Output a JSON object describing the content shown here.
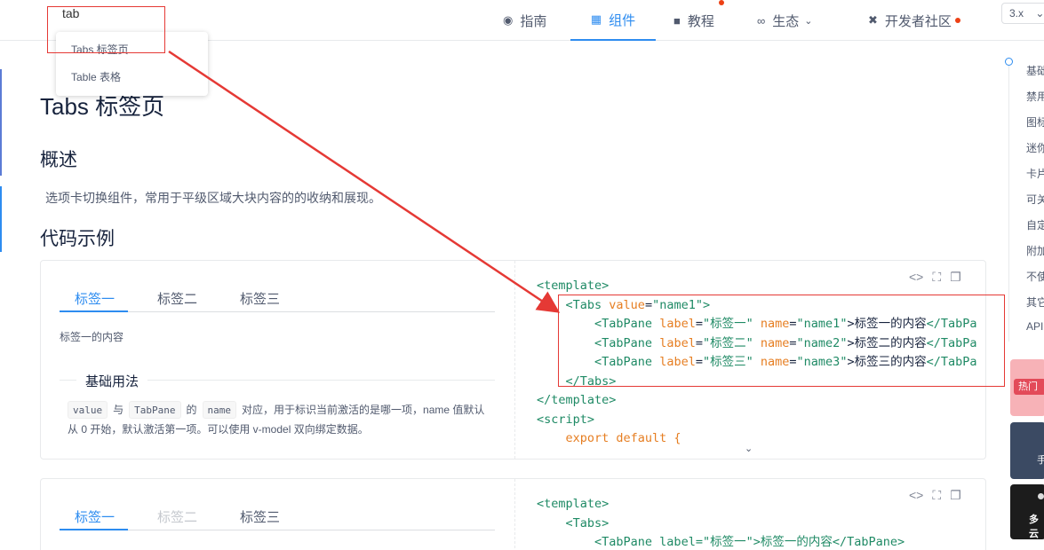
{
  "search": {
    "value": "tab"
  },
  "dropdown": {
    "options": [
      "Tabs 标签页",
      "Table 表格"
    ]
  },
  "nav": {
    "guide": "指南",
    "components": "组件",
    "tutorial": "教程",
    "ecosystem": "生态",
    "dev_community": "开发者社区",
    "version": "3.x"
  },
  "page": {
    "title": "Tabs 标签页",
    "overview_heading": "概述",
    "overview_text": "选项卡切换组件，常用于平级区域大块内容的的收纳和展现。",
    "examples_heading": "代码示例"
  },
  "demo1": {
    "tabs": [
      "标签一",
      "标签二",
      "标签三"
    ],
    "content": "标签一的内容",
    "legend": "基础用法",
    "explain": {
      "chip1": "value",
      "w1": "与",
      "chip2": "TabPane",
      "w2": "的",
      "chip3": "name",
      "rest": "对应，用于标识当前激活的是哪一项，name 值默认从 0 开始，默认激活第一项。可以使用 v-model 双向绑定数据。"
    },
    "code": {
      "l1": "<template>",
      "l2_tag": "<Tabs",
      "l2_attr": "value",
      "l2_val": "\"name1\"",
      "l2_end": ">",
      "l3_tag": "<TabPane",
      "l3_a1": "label",
      "l3_v1": "\"标签一\"",
      "l3_a2": "name",
      "l3_v2": "\"name1\"",
      "l3_text": ">标签一的内容",
      "l3_close": "</TabPa",
      "l4_tag": "<TabPane",
      "l4_a1": "label",
      "l4_v1": "\"标签二\"",
      "l4_a2": "name",
      "l4_v2": "\"name2\"",
      "l4_text": ">标签二的内容",
      "l4_close": "</TabPa",
      "l5_tag": "<TabPane",
      "l5_a1": "label",
      "l5_v1": "\"标签三\"",
      "l5_a2": "name",
      "l5_v2": "\"name3\"",
      "l5_text": ">标签三的内容",
      "l5_close": "</TabPa",
      "l6": "</Tabs>",
      "l7": "</template>",
      "l8": "<script>",
      "l9": "export default {"
    }
  },
  "demo2": {
    "tabs": [
      "标签一",
      "标签二",
      "标签三"
    ],
    "code": {
      "l1": "<template>",
      "l2": "<Tabs>",
      "l3": "<TabPane label=\"标签一\">标签一的内容</TabPane>"
    }
  },
  "anchors": [
    "基础",
    "禁用",
    "图标",
    "迷你",
    "卡片",
    "可关",
    "自定",
    "附加",
    "不使",
    "其它",
    "API"
  ],
  "promos": {
    "p1": "热门",
    "p2": "手",
    "p3": "多云"
  },
  "colors": {
    "accent": "#2d8cf0",
    "annotation": "#e53935",
    "dot": "#ed4014"
  }
}
